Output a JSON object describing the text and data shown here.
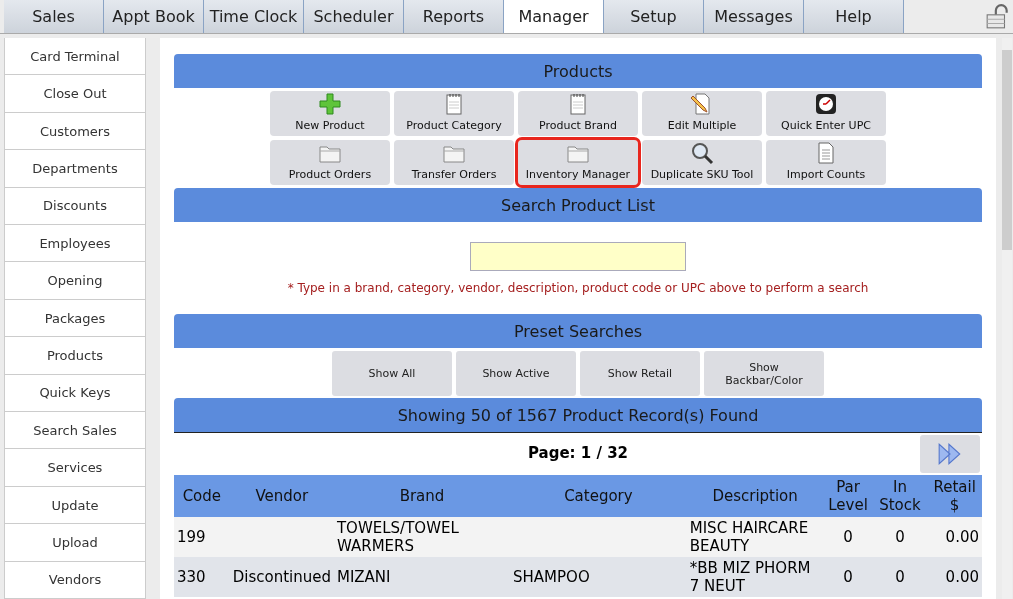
{
  "tabs": [
    {
      "label": "Sales",
      "selected": false
    },
    {
      "label": "Appt Book",
      "selected": false
    },
    {
      "label": "Time Clock",
      "selected": false
    },
    {
      "label": "Scheduler",
      "selected": false
    },
    {
      "label": "Reports",
      "selected": false
    },
    {
      "label": "Manager",
      "selected": true
    },
    {
      "label": "Setup",
      "selected": false
    },
    {
      "label": "Messages",
      "selected": false
    },
    {
      "label": "Help",
      "selected": false
    }
  ],
  "sidebar": {
    "items": [
      "Card Terminal",
      "Close Out",
      "Customers",
      "Departments",
      "Discounts",
      "Employees",
      "Opening",
      "Packages",
      "Products",
      "Quick Keys",
      "Search Sales",
      "Services",
      "Update",
      "Upload",
      "Vendors"
    ]
  },
  "products": {
    "title": "Products",
    "buttons": [
      {
        "label": "New Product",
        "highlighted": false
      },
      {
        "label": "Product Category",
        "highlighted": false
      },
      {
        "label": "Product Brand",
        "highlighted": false
      },
      {
        "label": "Edit Multiple",
        "highlighted": false
      },
      {
        "label": "Quick Enter UPC",
        "highlighted": false
      },
      {
        "label": "Product Orders",
        "highlighted": false
      },
      {
        "label": "Transfer Orders",
        "highlighted": false
      },
      {
        "label": "Inventory Manager",
        "highlighted": true
      },
      {
        "label": "Duplicate SKU Tool",
        "highlighted": false
      },
      {
        "label": "Import Counts",
        "highlighted": false
      }
    ]
  },
  "search": {
    "title": "Search Product List",
    "hint": "* Type in a brand, category, vendor, description, product code or UPC above to perform a search"
  },
  "presets": {
    "title": "Preset Searches",
    "buttons": [
      "Show All",
      "Show Active",
      "Show Retail",
      "Show Backbar/Color"
    ]
  },
  "results": {
    "title": "Showing 50 of 1567 Product Record(s) Found",
    "page": "Page: 1 / 32"
  },
  "table": {
    "columns": [
      "Code",
      "Vendor",
      "Brand",
      "Category",
      "Description",
      "Par Level",
      "In Stock",
      "Retail $"
    ],
    "rows": [
      [
        "199",
        "",
        "TOWELS/TOWEL WARMERS",
        "",
        "MISC HAIRCARE BEAUTY",
        "0",
        "0",
        "0.00"
      ],
      [
        "330",
        "Discontinued",
        "MIZANI",
        "SHAMPOO",
        "*BB MIZ PHORM 7 NEUT",
        "0",
        "0",
        "0.00"
      ]
    ]
  }
}
